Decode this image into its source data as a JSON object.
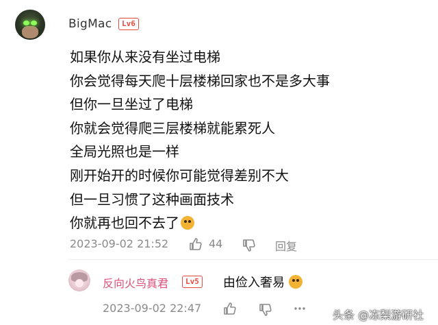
{
  "comment": {
    "username": "BigMac",
    "level": "Lv6",
    "lines": [
      "如果你从来没有坐过电梯",
      "你会觉得每天爬十层楼梯回家也不是多大事",
      "但你一旦坐过了电梯",
      "你就会觉得爬三层楼梯就能累死人",
      "全局光照也是一样",
      "刚开始开的时候你可能觉得差别不大",
      "但一旦习惯了这种画面技术",
      "你就再也回不去了"
    ],
    "timestamp": "2023-09-02 21:52",
    "like_count": "44",
    "reply_label": "回复"
  },
  "sub_reply": {
    "username": "反向火鸟真君",
    "level": "Lv5",
    "text": "由俭入奢易",
    "timestamp": "2023-09-02 22:47"
  },
  "watermark": "头条 @冻梨游研社",
  "colors": {
    "level_badge": "#e64a3b",
    "sub_username": "#e0507a",
    "meta_gray": "#8a8a8a"
  }
}
